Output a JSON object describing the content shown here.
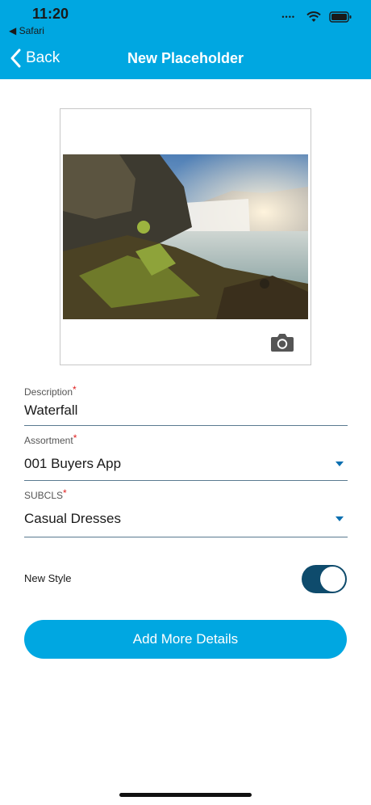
{
  "status_bar": {
    "time": "11:20",
    "back_app": "◀ Safari",
    "icons": [
      "cellular-signal-icon",
      "wifi-icon",
      "battery-icon"
    ]
  },
  "nav": {
    "back_label": "Back",
    "title": "New Placeholder"
  },
  "photo": {
    "subject": "waterfall-landscape-photo",
    "camera_icon": "camera-icon"
  },
  "form": {
    "description": {
      "label": "Description",
      "required_mark": "*",
      "value": "Waterfall"
    },
    "assortment": {
      "label": "Assortment",
      "required_mark": "*",
      "value": "001 Buyers App"
    },
    "subcls": {
      "label": "SUBCLS",
      "required_mark": "*",
      "value": "Casual Dresses"
    },
    "new_style": {
      "label": "New Style",
      "enabled": true
    }
  },
  "actions": {
    "add_more_details": "Add More Details"
  },
  "colors": {
    "brand": "#00a7e1",
    "toggle_on": "#0e4b6c",
    "required": "#e02020"
  }
}
